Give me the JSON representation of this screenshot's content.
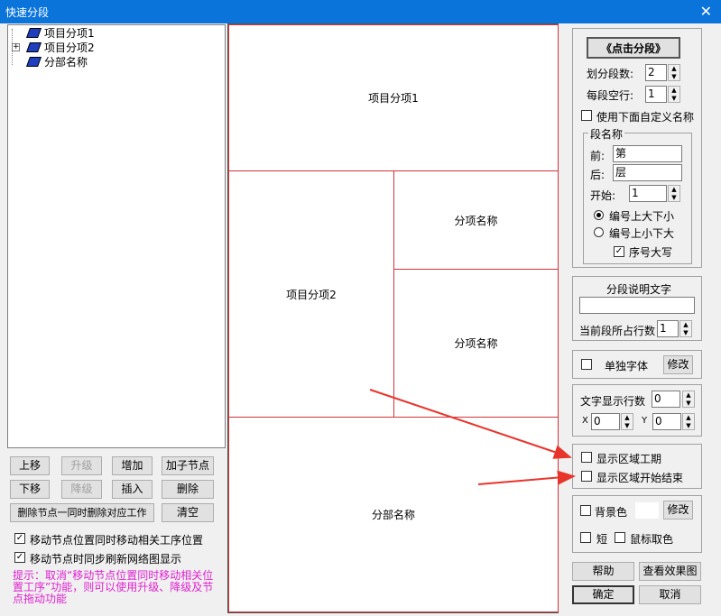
{
  "window": {
    "title": "快速分段",
    "close_glyph": "✕"
  },
  "tree": {
    "items": [
      {
        "label": "项目分项1",
        "expander": ""
      },
      {
        "label": "项目分项2",
        "expander": "+"
      },
      {
        "label": "分部名称",
        "expander": ""
      }
    ]
  },
  "buttons": {
    "up": "上移",
    "promote": "升级",
    "add": "增加",
    "add_child": "加子节点",
    "down": "下移",
    "demote": "降级",
    "insert": "插入",
    "delete": "删除",
    "delete_sync": "删除节点一同时删除对应工作",
    "clear": "清空"
  },
  "options": {
    "move_sync": "移动节点位置同时移动相关工序位置",
    "refresh_sync": "移动节点时同步刷新网络图显示",
    "hint": "提示：取消“移动节点位置同时移动相关位置工序”功能，则可以使用升级、降级及节点拖动功能"
  },
  "canvas": {
    "seg1": "项目分项1",
    "seg2": "项目分项2",
    "seg2a": "分项名称",
    "seg2b": "分项名称",
    "seg3": "分部名称"
  },
  "right": {
    "click_segment": "《点击分段》",
    "seg_count_label": "划分段数:",
    "seg_count": "2",
    "blank_rows_label": "每段空行:",
    "blank_rows": "1",
    "use_custom_name": "使用下面自定义名称",
    "seg_name_group": "段名称",
    "prefix_label": "前:",
    "prefix": "第",
    "suffix_label": "后:",
    "suffix": "层",
    "start_label": "开始:",
    "start": "1",
    "order_desc": "编号上大下小",
    "order_asc": "编号上小下大",
    "uppercase": "序号大写",
    "desc_group": "分段说明文字",
    "desc_value": "",
    "rows_label": "当前段所占行数",
    "rows": "1",
    "separate_font": "单独字体",
    "modify": "修改",
    "text_rows_label": "文字显示行数",
    "text_rows": "0",
    "x_label": "X",
    "x_value": "0",
    "y_label": "Y",
    "y_value": "0",
    "show_duration": "显示区域工期",
    "show_start_end": "显示区域开始结束",
    "bg_color": "背景色",
    "modify2": "修改",
    "short": "短",
    "pick_color": "鼠标取色",
    "help": "帮助",
    "preview": "查看效果图",
    "ok": "确定",
    "cancel": "取消"
  }
}
